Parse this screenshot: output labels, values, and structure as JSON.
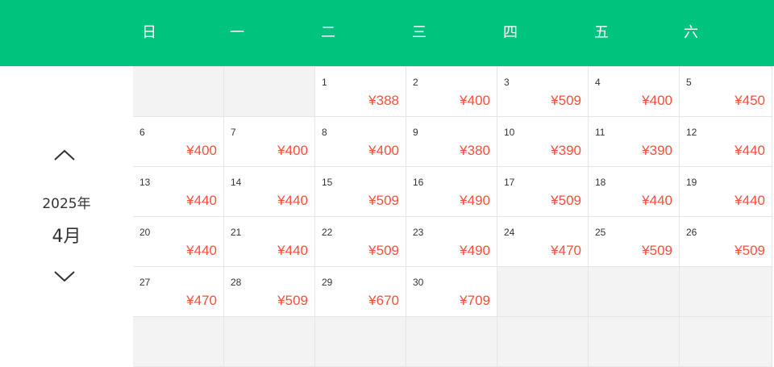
{
  "calendar": {
    "weekdays": [
      "日",
      "一",
      "二",
      "三",
      "四",
      "五",
      "六"
    ],
    "year": "2025年",
    "month": "4月",
    "prev_icon": "chevron-up-icon",
    "next_icon": "chevron-down-icon",
    "colors": {
      "header": "#00c37d",
      "price": "#ff4d3a",
      "empty": "#f3f3f3"
    },
    "days": [
      {
        "day": "1",
        "price": "¥388"
      },
      {
        "day": "2",
        "price": "¥400"
      },
      {
        "day": "3",
        "price": "¥509"
      },
      {
        "day": "4",
        "price": "¥400"
      },
      {
        "day": "5",
        "price": "¥450"
      },
      {
        "day": "6",
        "price": "¥400"
      },
      {
        "day": "7",
        "price": "¥400"
      },
      {
        "day": "8",
        "price": "¥400"
      },
      {
        "day": "9",
        "price": "¥380"
      },
      {
        "day": "10",
        "price": "¥390"
      },
      {
        "day": "11",
        "price": "¥390"
      },
      {
        "day": "12",
        "price": "¥440"
      },
      {
        "day": "13",
        "price": "¥440"
      },
      {
        "day": "14",
        "price": "¥440"
      },
      {
        "day": "15",
        "price": "¥509"
      },
      {
        "day": "16",
        "price": "¥490"
      },
      {
        "day": "17",
        "price": "¥509"
      },
      {
        "day": "18",
        "price": "¥440"
      },
      {
        "day": "19",
        "price": "¥440"
      },
      {
        "day": "20",
        "price": "¥440"
      },
      {
        "day": "21",
        "price": "¥440"
      },
      {
        "day": "22",
        "price": "¥509"
      },
      {
        "day": "23",
        "price": "¥490"
      },
      {
        "day": "24",
        "price": "¥470"
      },
      {
        "day": "25",
        "price": "¥509"
      },
      {
        "day": "26",
        "price": "¥509"
      },
      {
        "day": "27",
        "price": "¥470"
      },
      {
        "day": "28",
        "price": "¥509"
      },
      {
        "day": "29",
        "price": "¥670"
      },
      {
        "day": "30",
        "price": "¥709"
      }
    ]
  }
}
